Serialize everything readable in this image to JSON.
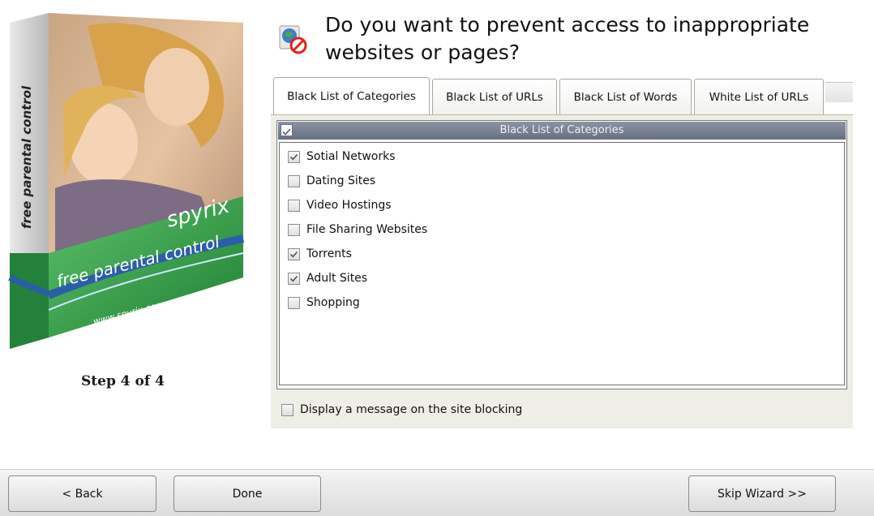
{
  "product_box": {
    "side_text": "free parental control",
    "brand": "spyrix",
    "front_text": "free parental control",
    "url": "www.spyrix.com"
  },
  "step_label": "Step 4 of 4",
  "title": "Do you want to prevent access to inappropriate websites or pages?",
  "tabs": [
    {
      "label": "Black List of Categories",
      "active": true
    },
    {
      "label": "Black List of URLs",
      "active": false
    },
    {
      "label": "Black List of Words",
      "active": false
    },
    {
      "label": "White List of URLs",
      "active": false
    }
  ],
  "list": {
    "header": "Black List of Categories",
    "header_checked": true,
    "items": [
      {
        "label": "Sotial Networks",
        "checked": true
      },
      {
        "label": "Dating Sites",
        "checked": false
      },
      {
        "label": "Video Hostings",
        "checked": false
      },
      {
        "label": "File Sharing Websites",
        "checked": false
      },
      {
        "label": "Torrents",
        "checked": true
      },
      {
        "label": "Adult Sites",
        "checked": true
      },
      {
        "label": "Shopping",
        "checked": false
      }
    ]
  },
  "display_message": {
    "label": "Display a message on the site blocking",
    "checked": false
  },
  "buttons": {
    "back": "< Back",
    "done": "Done",
    "skip": "Skip Wizard >>"
  },
  "colors": {
    "box_green": "#2f9a45",
    "box_blue": "#2a5fa8",
    "header_bar": "#767e91"
  }
}
